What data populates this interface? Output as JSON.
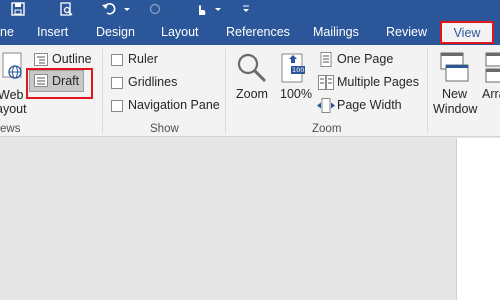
{
  "tabs": {
    "partial_home": "ne",
    "insert": "Insert",
    "design": "Design",
    "layout": "Layout",
    "references": "References",
    "mailings": "Mailings",
    "review": "Review",
    "view": "View"
  },
  "views_group": {
    "web_layout_line1": "Web",
    "web_layout_line2": "ayout",
    "outline": "Outline",
    "draft": "Draft",
    "label": "ews"
  },
  "show_group": {
    "ruler": "Ruler",
    "gridlines": "Gridlines",
    "navigation_pane": "Navigation Pane",
    "label": "Show"
  },
  "zoom_group": {
    "zoom": "Zoom",
    "hundred_percent": "100%",
    "hundred_icon_text": "100",
    "one_page": "One Page",
    "multiple_pages": "Multiple Pages",
    "page_width": "Page Width",
    "label": "Zoom"
  },
  "window_group": {
    "new_window_line1": "New",
    "new_window_line2": "Window",
    "arrange_partial": "Arra"
  },
  "colors": {
    "ribbon_blue": "#2b579a",
    "highlight_red": "#e0161d"
  }
}
